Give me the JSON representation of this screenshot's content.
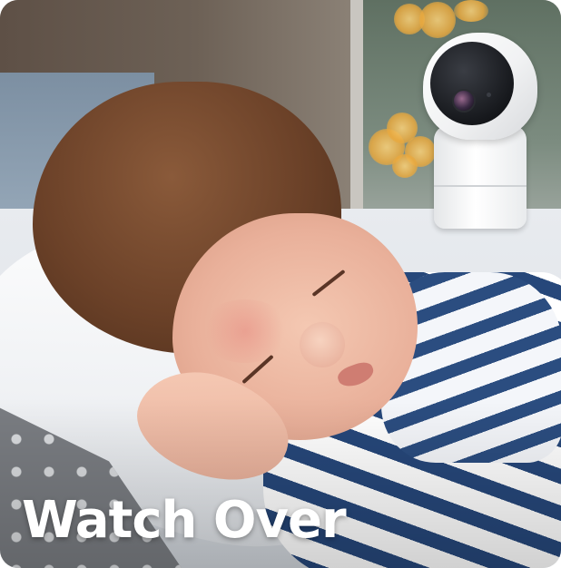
{
  "banner": {
    "headline": "Watch Over"
  },
  "photo": {
    "subject_icon": "sleeping-baby-photo",
    "product_icon": "security-camera-icon"
  },
  "colors": {
    "headline_text": "#ffffff",
    "pajama_stripe": "#26477a",
    "camera_body": "#ffffff",
    "camera_face": "#16181c"
  }
}
